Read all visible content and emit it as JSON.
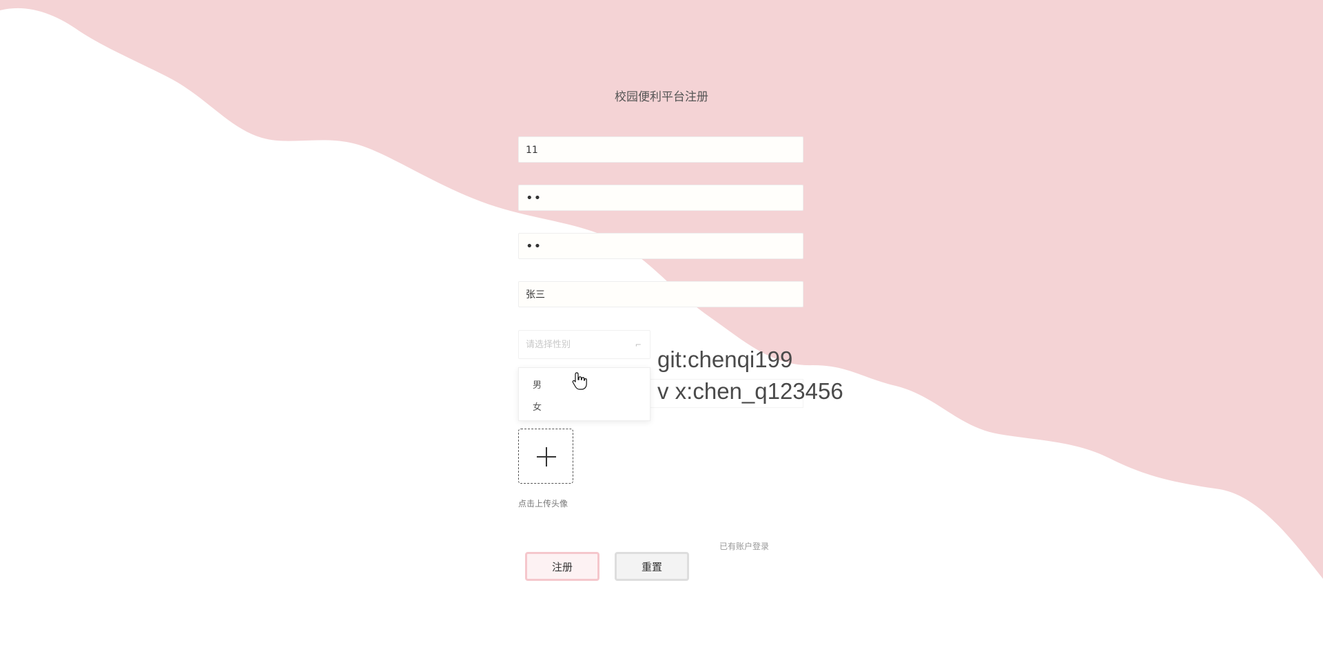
{
  "page": {
    "title": "校园便利平台注册"
  },
  "colors": {
    "wave": "#f4d3d5",
    "background": "#ffffff",
    "register_button_bg": "#fdf2f3",
    "register_button_border": "#f5c7cc",
    "reset_button_bg": "#f3f3f3"
  },
  "form": {
    "username": {
      "value": "11"
    },
    "password": {
      "value": "••"
    },
    "confirm_password": {
      "value": "••"
    },
    "name": {
      "value": "张三"
    },
    "gender": {
      "placeholder": "请选择性别",
      "options": [
        "男",
        "女"
      ],
      "dropdown_open": true
    },
    "avatar": {
      "upload_icon": "plus-icon",
      "hint": "点击上传头像"
    }
  },
  "watermark": {
    "line1": "git:chenqi199",
    "line2": "v x:chen_q123456"
  },
  "actions": {
    "register_label": "注册",
    "reset_label": "重置",
    "login_link": "已有账户登录"
  }
}
